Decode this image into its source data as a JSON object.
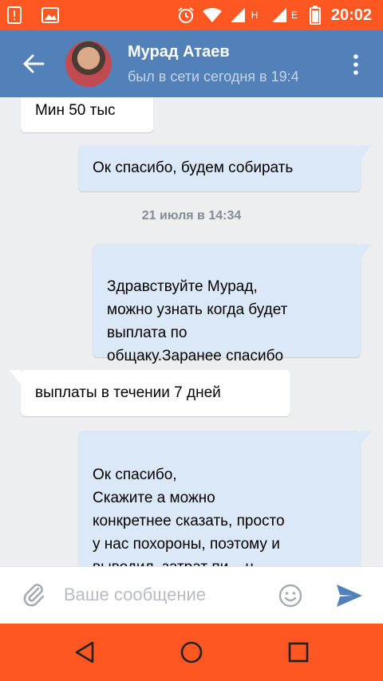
{
  "status_bar": {
    "time": "20:02",
    "network_label_1": "H",
    "network_label_2": "E",
    "icons": [
      "alert-icon",
      "image-icon",
      "alarm-icon",
      "wifi-icon",
      "signal-icon",
      "signal-icon",
      "battery-icon"
    ]
  },
  "header": {
    "name": "Мурад Атаев",
    "last_seen": "был в сети сегодня в 19:4"
  },
  "messages": [
    {
      "direction": "in",
      "text": "Мин 50 тыс"
    },
    {
      "direction": "out",
      "text": "Ок спасибо, будем собирать"
    },
    {
      "direction": "out",
      "text": "Здравствуйте Мурад,\nможно узнать когда будет\nвыплата по\nобщаку.Заранее спасибо"
    },
    {
      "direction": "in",
      "text": "выплаты в течении 7 дней"
    },
    {
      "direction": "out",
      "text": "Ок спасибо,\nСкажите а можно\nконкретнее сказать, просто\nу нас похороны, поэтому и\nвыводил, затрат пи....ц\nсколько, мне просто надо"
    }
  ],
  "date_separator": "21 июля в 14:34",
  "input": {
    "placeholder": "Ваше сообщение"
  },
  "colors": {
    "status_bar": "#ff5722",
    "header": "#5181b8",
    "chat_bg": "#edeef0",
    "outgoing_bubble": "#dbe8f7",
    "incoming_bubble": "#ffffff",
    "send_icon": "#5181b8"
  }
}
